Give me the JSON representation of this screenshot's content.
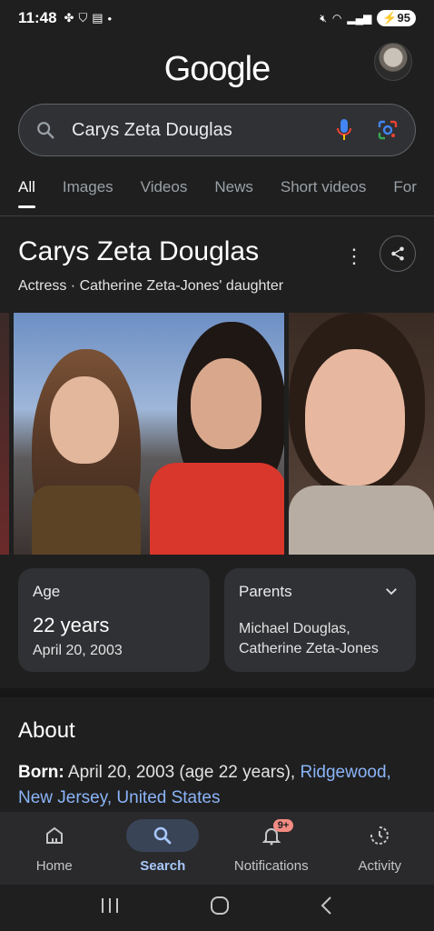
{
  "status": {
    "time": "11:48",
    "battery": "95"
  },
  "header": {
    "logo": "Google"
  },
  "search": {
    "query": "Carys Zeta Douglas"
  },
  "tabs": [
    {
      "label": "All",
      "active": true
    },
    {
      "label": "Images"
    },
    {
      "label": "Videos"
    },
    {
      "label": "News"
    },
    {
      "label": "Short videos"
    },
    {
      "label": "For"
    }
  ],
  "entity": {
    "title": "Carys Zeta Douglas",
    "subtitle": "Actress · Catherine Zeta-Jones' daughter"
  },
  "cards": {
    "age": {
      "label": "Age",
      "value": "22 years",
      "detail": "April 20, 2003"
    },
    "parents": {
      "label": "Parents",
      "value_line1": "Michael Douglas,",
      "value_line2": "Catherine Zeta-Jones"
    }
  },
  "about": {
    "title": "About",
    "born_label": "Born:",
    "born_text": "April 20, 2003 (age 22 years),",
    "link1": "Ridgewood,",
    "link2": "New Jersey,",
    "link3": "United States"
  },
  "bottom_nav": [
    {
      "label": "Home",
      "icon": "home-icon"
    },
    {
      "label": "Search",
      "icon": "search-icon",
      "active": true
    },
    {
      "label": "Notifications",
      "icon": "bell-icon",
      "badge": "9+"
    },
    {
      "label": "Activity",
      "icon": "activity-icon"
    }
  ],
  "colors": {
    "background": "#1f1f1f",
    "link": "#8ab4f8",
    "active_nav": "#a8c7fa"
  }
}
